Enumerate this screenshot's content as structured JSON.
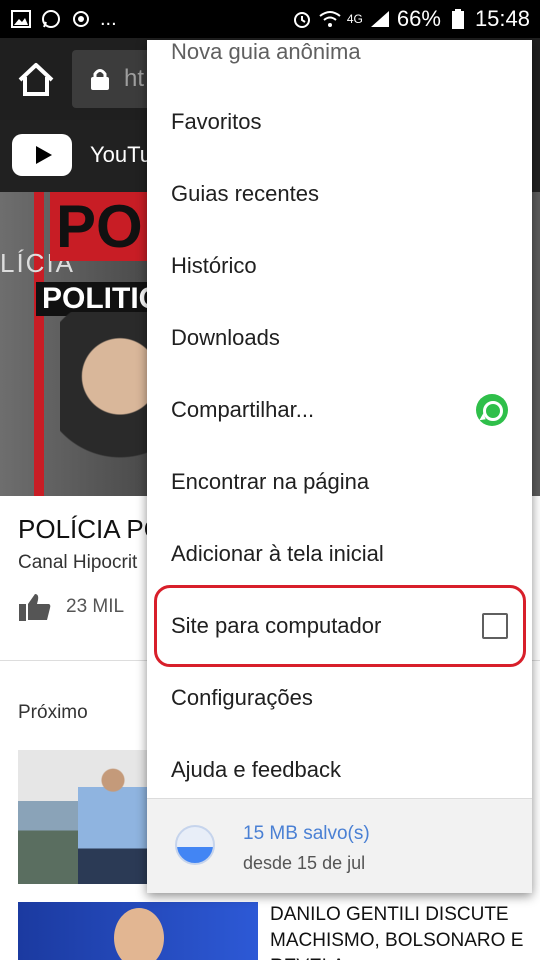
{
  "status_bar": {
    "left_icons": [
      "image-icon",
      "whatsapp-icon",
      "sync-icon"
    ],
    "overflow": "...",
    "network_label": "4G",
    "battery": "66%",
    "time": "15:48"
  },
  "toolbar": {
    "url_text": "ht"
  },
  "youtube_bar": {
    "title": "YouTu"
  },
  "video": {
    "overlay_big": "PO",
    "overlay_mid": "POLITIC",
    "overlay_side": "LÍCIA",
    "title": "POLÍCIA PO",
    "channel": "Canal Hipocrit",
    "likes": "23 MIL"
  },
  "next": {
    "label": "Próximo",
    "second_title": "DANILO GENTILI DISCUTE MACHISMO, BOLSONARO E REVELA"
  },
  "menu": {
    "partial_top": "Nova guia anônima",
    "items": [
      {
        "label": "Favoritos"
      },
      {
        "label": "Guias recentes"
      },
      {
        "label": "Histórico"
      },
      {
        "label": "Downloads"
      },
      {
        "label": "Compartilhar...",
        "trailing": "whatsapp-icon"
      },
      {
        "label": "Encontrar na página"
      },
      {
        "label": "Adicionar à tela inicial"
      },
      {
        "label": "Site para computador",
        "trailing": "checkbox",
        "checked": false
      },
      {
        "label": "Configurações"
      },
      {
        "label": "Ajuda e feedback"
      }
    ],
    "footer": {
      "saved": "15 MB salvo(s)",
      "since": "desde 15 de jul"
    }
  },
  "colors": {
    "accent_highlight": "#d81f2a",
    "data_saver_blue": "#4a80d4",
    "whatsapp_green": "#2fbf4a"
  }
}
